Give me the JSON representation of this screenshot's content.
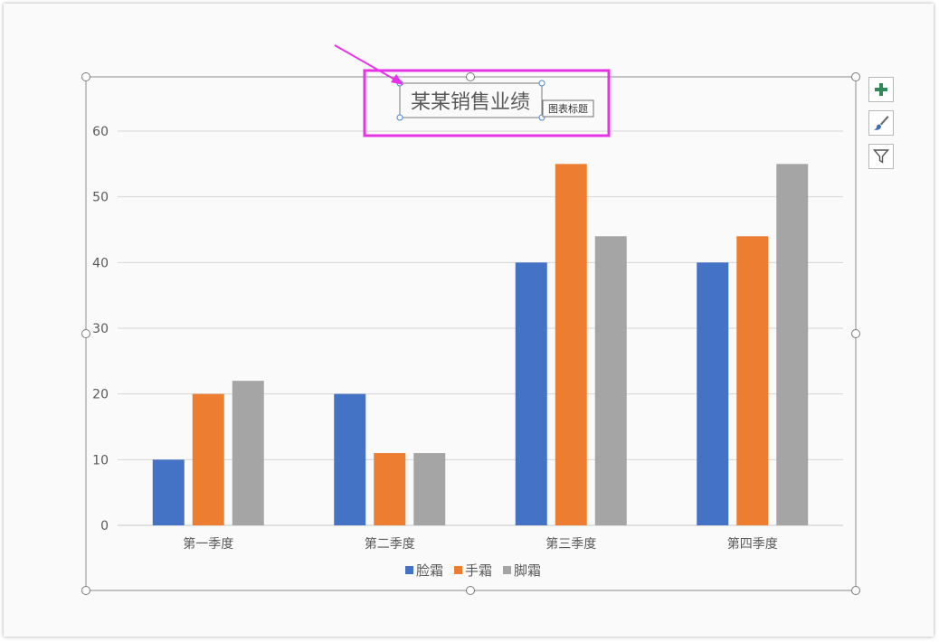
{
  "colors": {
    "series_1": "#4472C4",
    "series_2": "#ED7D31",
    "series_3": "#A5A5A5",
    "highlight": "#E633E6",
    "add_icon": "#2E8B57"
  },
  "tooltip": {
    "text": "图表标题"
  },
  "side_buttons": [
    {
      "icon": "plus-icon"
    },
    {
      "icon": "brush-icon"
    },
    {
      "icon": "filter-icon"
    }
  ],
  "chart_data": {
    "type": "bar",
    "title": "某某销售业绩",
    "categories": [
      "第一季度",
      "第二季度",
      "第三季度",
      "第四季度"
    ],
    "series": [
      {
        "name": "脸霜",
        "values": [
          10,
          20,
          40,
          40
        ]
      },
      {
        "name": "手霜",
        "values": [
          20,
          11,
          55,
          44
        ]
      },
      {
        "name": "脚霜",
        "values": [
          22,
          11,
          44,
          55
        ]
      }
    ],
    "ylim": [
      0,
      60
    ],
    "yticks": [
      0,
      10,
      20,
      30,
      40,
      50,
      60
    ],
    "grid": true,
    "legend": "bottom"
  }
}
